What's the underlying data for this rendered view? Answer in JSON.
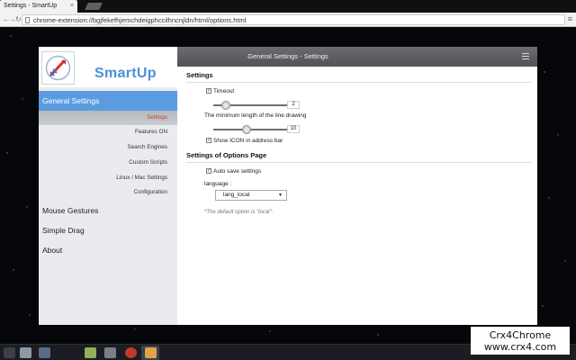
{
  "browser": {
    "tab_title": "Settings - SmartUp",
    "tab_close": "×",
    "url": "chrome-extension://bgjfekefhjemchdeigphccilhncnjldn/html/options.html",
    "back_glyph": "←",
    "forward_glyph": "→",
    "reload_glyph": "↻",
    "menu_glyph": "≡"
  },
  "window": {
    "title": "General Settings - Settings"
  },
  "sidebar": {
    "brand": "SmartUp",
    "items": [
      {
        "label": "General Settings"
      },
      {
        "label": "Mouse Gestures"
      },
      {
        "label": "Simple Drag"
      },
      {
        "label": "About"
      }
    ],
    "subitems": [
      {
        "label": "Settings"
      },
      {
        "label": "Features ON"
      },
      {
        "label": "Search Engines"
      },
      {
        "label": "Custom Scripts"
      },
      {
        "label": "Linux / Mac Settings"
      },
      {
        "label": "Configuration"
      }
    ]
  },
  "settings": {
    "section_title": "Settings",
    "timeout": {
      "label": "Timeout",
      "checked": true,
      "check_glyph": "✓",
      "value": "2",
      "slider_fraction": 0.12
    },
    "min_length": {
      "label": "The minimum length of the line drawing",
      "value": "10",
      "slider_fraction": 0.42
    },
    "show_icon": {
      "label": "Show ICON in address bar",
      "checked": true
    }
  },
  "options_page": {
    "section_title": "Settings of Options Page",
    "autosave": {
      "label": "Auto save settings",
      "checked": true
    },
    "language_label": "language :",
    "language_value": "lang_local",
    "select_chevron": "▼",
    "hint": "*The default option is \"local\"."
  },
  "watermark": {
    "line1": "Crx4Chrome",
    "line2": "www.crx4.com"
  },
  "colors": {
    "accent": "#5b9be0",
    "active_sub": "#c4441c",
    "header": "#5a5c60"
  },
  "taskbar": {
    "icons": [
      "start-icon",
      "file-explorer-icon",
      "folder-icon",
      "media-player-icon",
      "settings-icon",
      "chrome-icon",
      "active-window-icon"
    ]
  }
}
